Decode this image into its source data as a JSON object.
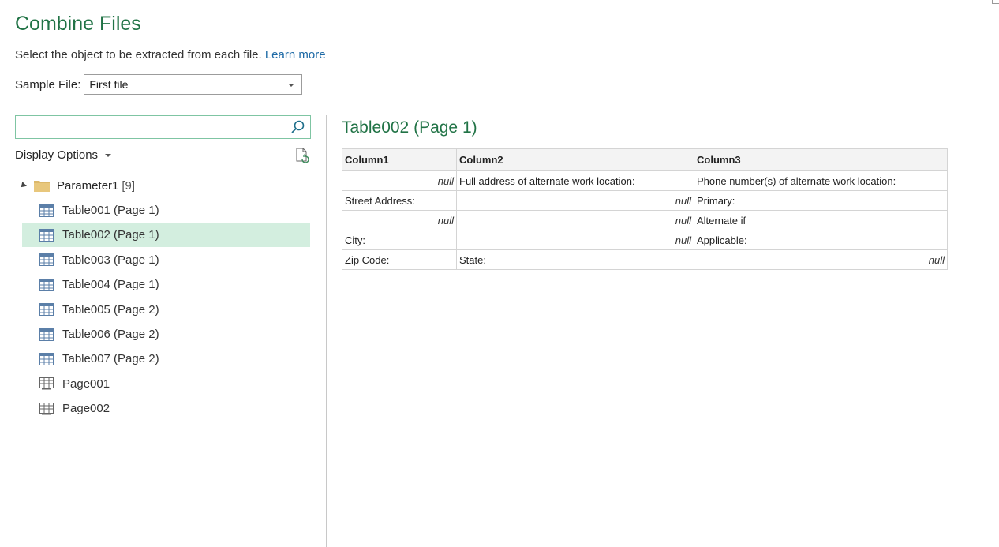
{
  "dialog": {
    "title": "Combine Files",
    "subtitle": "Select the object to be extracted from each file.",
    "learn_more": "Learn more"
  },
  "sample_file": {
    "label": "Sample File:",
    "value": "First file"
  },
  "search": {
    "value": "",
    "placeholder": ""
  },
  "display_options": {
    "label": "Display Options"
  },
  "tree": {
    "folder": {
      "label": "Parameter1",
      "count": "[9]"
    },
    "items": [
      {
        "label": "Table001 (Page 1)",
        "icon": "table-icon",
        "selected": false
      },
      {
        "label": "Table002 (Page 1)",
        "icon": "table-icon",
        "selected": true
      },
      {
        "label": "Table003 (Page 1)",
        "icon": "table-icon",
        "selected": false
      },
      {
        "label": "Table004 (Page 1)",
        "icon": "table-icon",
        "selected": false
      },
      {
        "label": "Table005 (Page 2)",
        "icon": "table-icon",
        "selected": false
      },
      {
        "label": "Table006 (Page 2)",
        "icon": "table-icon",
        "selected": false
      },
      {
        "label": "Table007 (Page 2)",
        "icon": "table-icon",
        "selected": false
      },
      {
        "label": "Page001",
        "icon": "page-icon",
        "selected": false
      },
      {
        "label": "Page002",
        "icon": "page-icon",
        "selected": false
      }
    ]
  },
  "preview": {
    "title": "Table002 (Page 1)",
    "columns": [
      "Column1",
      "Column2",
      "Column3"
    ],
    "rows": [
      [
        "null",
        "Full address of alternate work location:",
        "Phone number(s) of alternate work location:"
      ],
      [
        "Street Address:",
        "null",
        "Primary:"
      ],
      [
        "null",
        "null",
        "Alternate if"
      ],
      [
        "City:",
        "null",
        "Applicable:"
      ],
      [
        "Zip Code:",
        "State:",
        "null"
      ]
    ]
  },
  "colors": {
    "accent_green": "#217346",
    "selection": "#d3eedf",
    "link": "#1e6aa6"
  }
}
